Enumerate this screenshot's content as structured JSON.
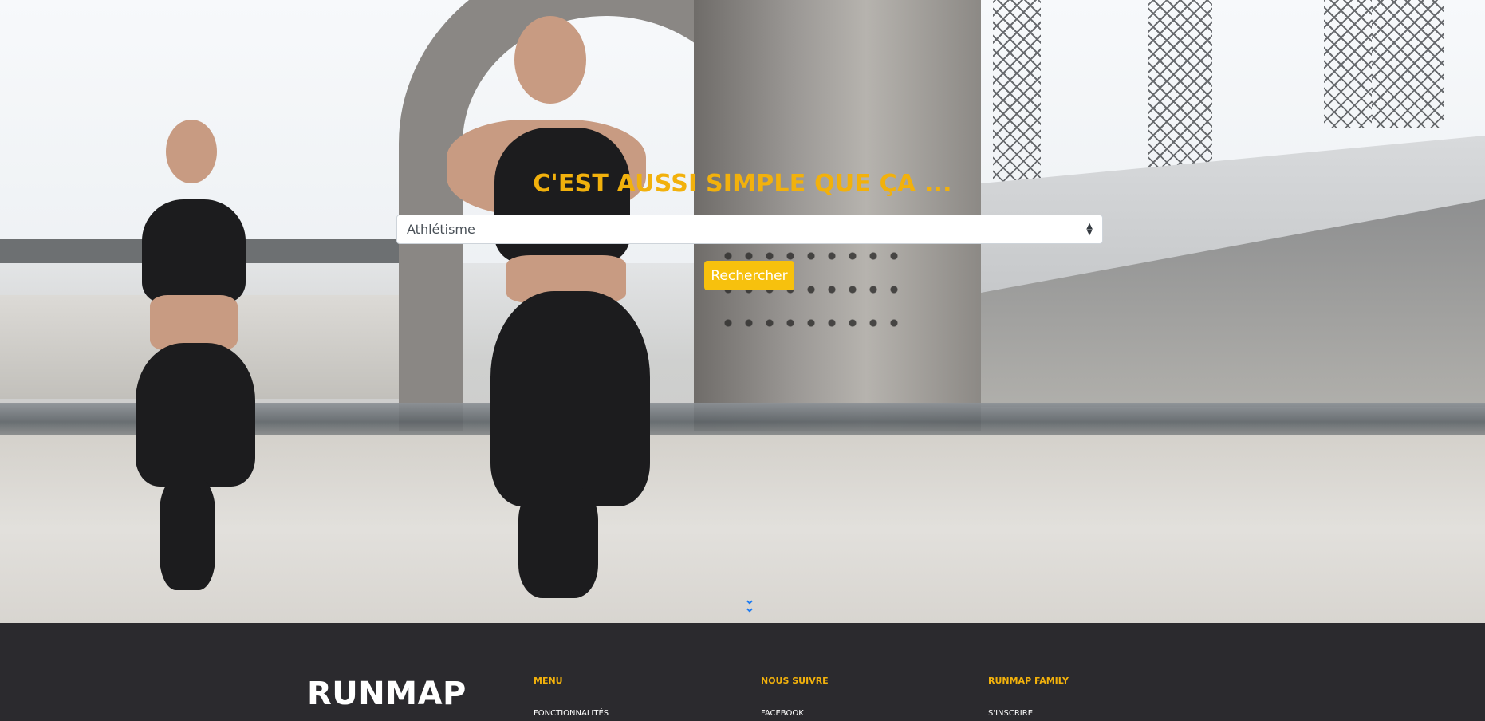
{
  "hero": {
    "tagline": "C'EST AUSSI SIMPLE QUE ÇA ...",
    "sport_select": {
      "selected": "Athlétisme"
    },
    "search_button_label": "Rechercher",
    "scroll_icon": "double-chevron-down-icon"
  },
  "footer": {
    "logo": "RUNMAP",
    "columns": [
      {
        "title": "MENU",
        "links": [
          "FONCTIONNALITÉS"
        ]
      },
      {
        "title": "NOUS SUIVRE",
        "links": [
          "FACEBOOK"
        ]
      },
      {
        "title": "RUNMAP FAMILY",
        "links": [
          "S'INSCRIRE"
        ]
      }
    ]
  },
  "colors": {
    "accent_yellow": "#f2b10c",
    "button_yellow": "#f7c10d",
    "footer_bg": "#2b2a2e",
    "chevron_blue": "#1e7cf2"
  }
}
